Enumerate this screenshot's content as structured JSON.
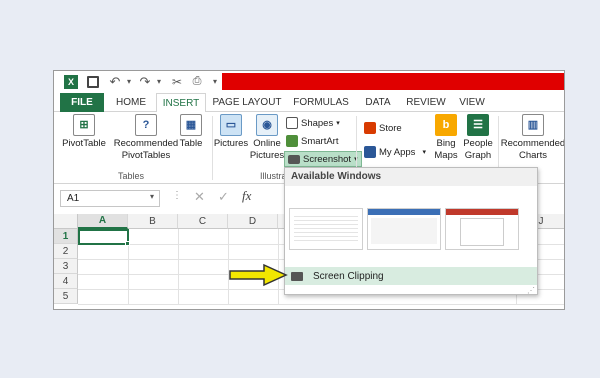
{
  "colors": {
    "excel_green": "#217346",
    "redaction": "#e00000",
    "arrow": "#f2e600",
    "clip_highlight": "#d8ece0"
  },
  "tabs": [
    "FILE",
    "HOME",
    "INSERT",
    "PAGE LAYOUT",
    "FORMULAS",
    "DATA",
    "REVIEW",
    "VIEW"
  ],
  "active_tab": "INSERT",
  "ribbon": {
    "pivottable": "PivotTable",
    "recommended_pivottables": "Recommended PivotTables",
    "table": "Table",
    "tables_group": "Tables",
    "pictures": "Pictures",
    "online_pictures": "Online Pictures",
    "shapes": "Shapes",
    "smartart": "SmartArt",
    "screenshot": "Screenshot",
    "illustrations_group": "Illustra",
    "store": "Store",
    "my_apps": "My Apps",
    "bing_maps": "Bing Maps",
    "people_graph": "People Graph",
    "recommended_charts": "Recommended Charts"
  },
  "formula_bar": {
    "name_box": "A1",
    "fx": "fx"
  },
  "grid": {
    "columns": [
      "A",
      "B",
      "C",
      "D",
      "J"
    ],
    "rows": [
      "1",
      "2",
      "3",
      "4",
      "5"
    ]
  },
  "dropdown": {
    "header": "Available Windows",
    "screen_clipping": "Screen Clipping"
  }
}
